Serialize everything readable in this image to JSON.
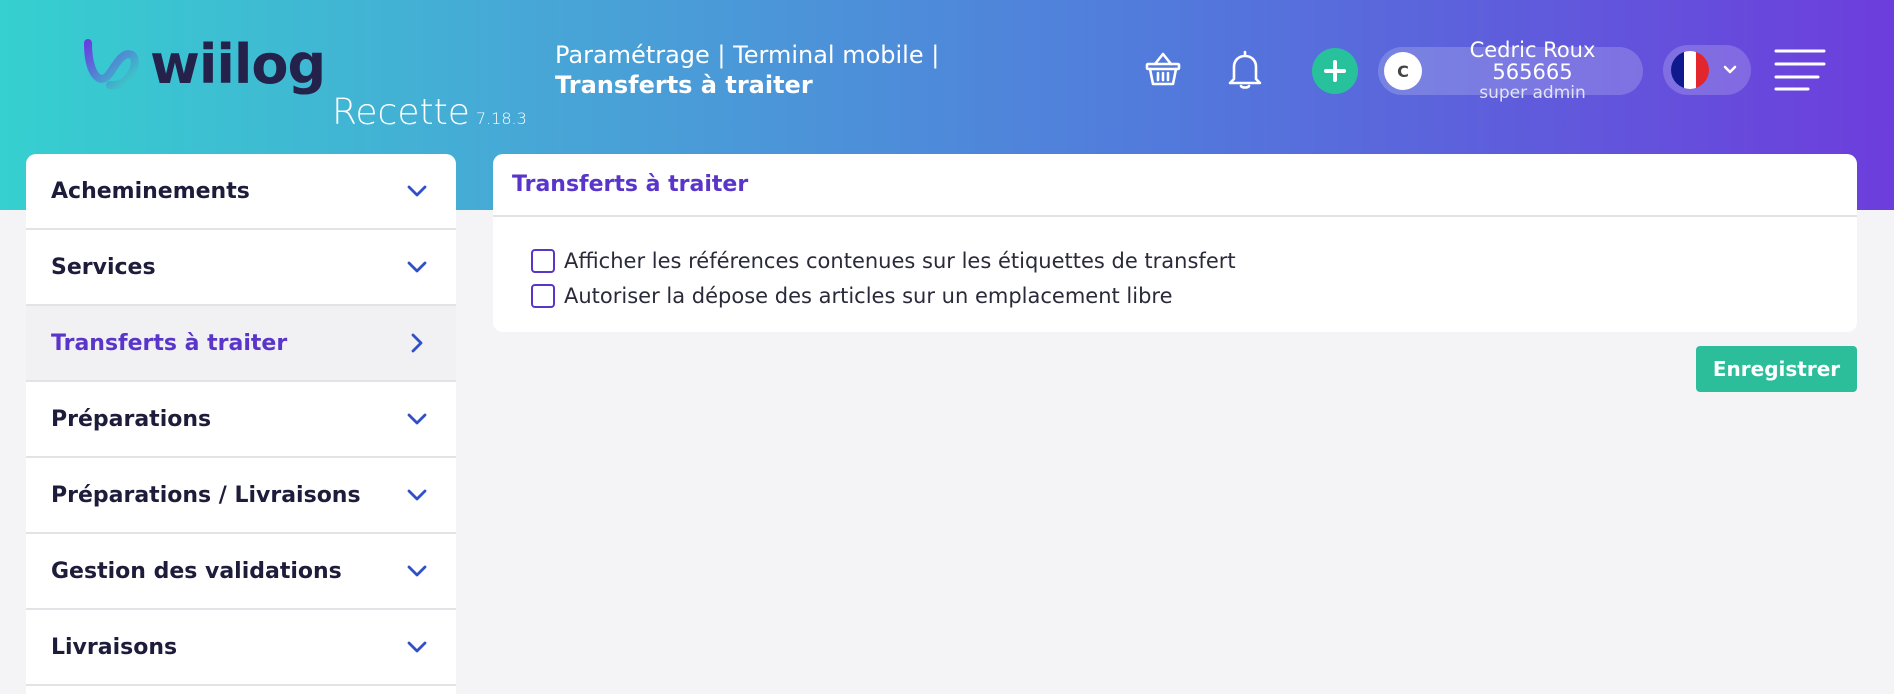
{
  "app": {
    "brand": "wiilog",
    "environment": "Recette",
    "version": "7.18.3"
  },
  "breadcrumb": {
    "path": "Paramétrage | Terminal mobile |",
    "current": "Transferts à traiter"
  },
  "header": {
    "icons": [
      "basket-icon",
      "bell-icon",
      "plus-icon",
      "menu-icon"
    ],
    "user": {
      "initial": "C",
      "name": "Cedric Roux 565665",
      "role": "super admin"
    },
    "language": {
      "flag": "fr",
      "colors": [
        "#0f1a8f",
        "#ffffff",
        "#e3262b"
      ]
    }
  },
  "sidebar": {
    "items": [
      {
        "label": "Acheminements",
        "state": "collapsed"
      },
      {
        "label": "Services",
        "state": "collapsed"
      },
      {
        "label": "Transferts à traiter",
        "state": "active"
      },
      {
        "label": "Préparations",
        "state": "collapsed"
      },
      {
        "label": "Préparations / Livraisons",
        "state": "collapsed"
      },
      {
        "label": "Gestion des validations",
        "state": "collapsed"
      },
      {
        "label": "Livraisons",
        "state": "collapsed"
      }
    ]
  },
  "main": {
    "title": "Transferts à traiter",
    "options": [
      {
        "label": "Afficher les références contenues sur les étiquettes de transfert",
        "checked": false
      },
      {
        "label": "Autoriser la dépose des articles sur un emplacement libre",
        "checked": false
      }
    ],
    "save_label": "Enregistrer"
  },
  "colors": {
    "accent": "#5a35c9",
    "primary_button": "#2cbe9a",
    "header_gradient": [
      "#35d0cf",
      "#6d3ddc"
    ]
  }
}
